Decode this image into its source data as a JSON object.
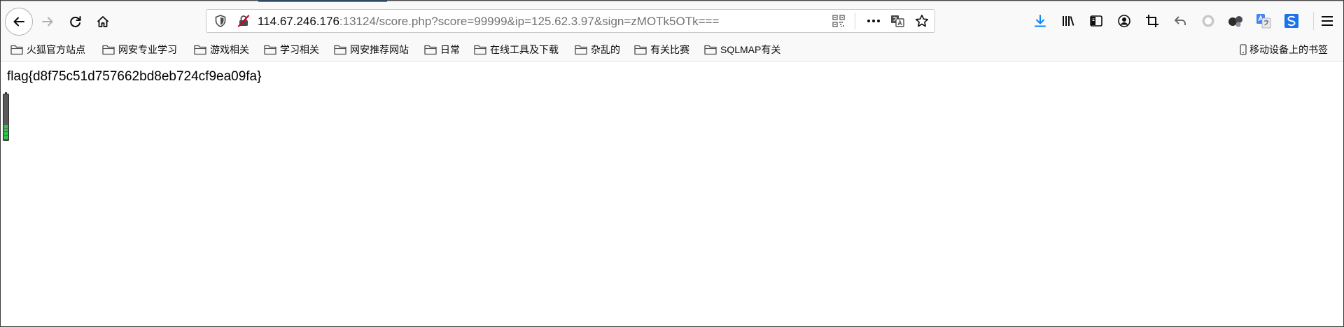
{
  "browser": {
    "url_host": "114.67.246.176",
    "url_rest": ":13124/score.php?score=99999&ip=125.62.3.97&sign=zMOTk5OTk===",
    "accent_color": "#0a84ff"
  },
  "toolbar": {
    "icons": [
      "back-icon",
      "forward-icon",
      "reload-icon",
      "home-icon",
      "shield-icon",
      "insecure-connection-icon",
      "qr-code-icon",
      "more-icon",
      "translate-icon",
      "star-icon",
      "download-icon",
      "library-icon",
      "sidebar-icon",
      "account-icon",
      "crop-icon",
      "undo-icon",
      "record-icon",
      "extension-icon",
      "translate-extension-icon",
      "sync-extension-icon",
      "menu-icon"
    ]
  },
  "bookmarks": {
    "items": [
      {
        "label": "火狐官方站点"
      },
      {
        "label": "网安专业学习"
      },
      {
        "label": "游戏相关"
      },
      {
        "label": "学习相关"
      },
      {
        "label": "网安推荐网站"
      },
      {
        "label": "日常"
      },
      {
        "label": "在线工具及下载"
      },
      {
        "label": "杂乱的"
      },
      {
        "label": "有关比赛"
      },
      {
        "label": "SQLMAP有关"
      }
    ],
    "mobile_label": "移动设备上的书签"
  },
  "page": {
    "flag_text": "flag{d8f75c51d757662bd8eb724cf9ea09fa}"
  }
}
